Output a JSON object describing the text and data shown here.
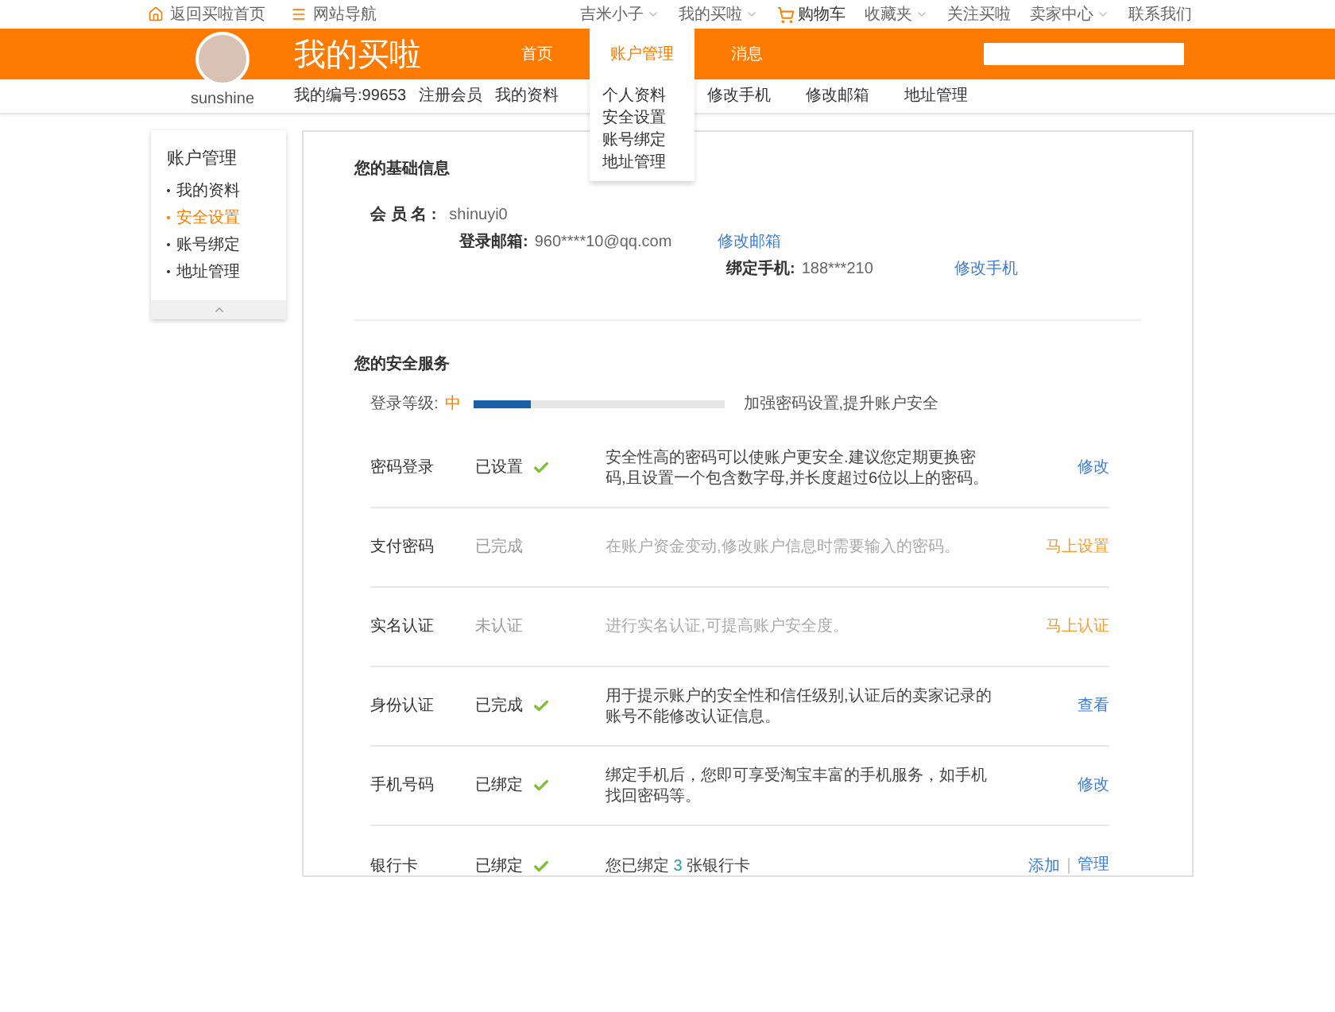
{
  "top_bar": {
    "left": [
      {
        "label": "返回买啦首页",
        "kind": "home"
      },
      {
        "label": "网站导航",
        "kind": "menu"
      }
    ],
    "right": [
      {
        "label": "吉米小子",
        "kind": "plain",
        "dropdown": true
      },
      {
        "label": "我的买啦",
        "kind": "plain",
        "dropdown": true
      },
      {
        "label": "购物车",
        "kind": "cart",
        "dropdown": false
      },
      {
        "label": "收藏夹",
        "kind": "plain",
        "dropdown": true
      },
      {
        "label": "关注买啦",
        "kind": "plain",
        "dropdown": false
      },
      {
        "label": "卖家中心",
        "kind": "plain",
        "dropdown": true
      },
      {
        "label": "联系我们",
        "kind": "plain",
        "dropdown": false
      }
    ]
  },
  "header": {
    "title": "我的买啦",
    "username": "sunshine",
    "nav": [
      {
        "label": "首页",
        "selected": false
      },
      {
        "label": "账户管理",
        "selected": true,
        "expanded": true,
        "menu": [
          "个人资料",
          "安全设置",
          "账号绑定",
          "地址管理"
        ]
      },
      {
        "label": "消息",
        "selected": false
      }
    ]
  },
  "subnav": {
    "left": [
      "我的编号:99653",
      "注册会员",
      "我的资料"
    ],
    "right": [
      "修改手机",
      "修改邮箱",
      "地址管理"
    ]
  },
  "sidebar": {
    "title": "账户管理",
    "items": [
      {
        "label": "我的资料",
        "selected": false
      },
      {
        "label": "安全设置",
        "selected": true
      },
      {
        "label": "账号绑定",
        "selected": false
      },
      {
        "label": "地址管理",
        "selected": false
      }
    ]
  },
  "basic_info": {
    "title": "您的基础信息",
    "member_label": "会 员 名 :",
    "member_value": "shinuyi0",
    "email_label": "登录邮箱:",
    "email_value": "960****10@qq.com",
    "email_link": "修改邮箱",
    "phone_label": "绑定手机:",
    "phone_value": "188***210",
    "phone_link": "修改手机"
  },
  "security": {
    "title": "您的安全服务",
    "level_label": "登录等级:",
    "level_value": "中",
    "level": 0.23,
    "level_hint": "加强密码设置,提升账户安全",
    "rows": [
      {
        "name": "密码登录",
        "status": "已设置",
        "done": true,
        "description": [
          {
            "text": "安全性高的密码可以使账户更安全.建议您定期更换密码,且设置一个包含数字母,并长度超过6位以上的密码。",
            "kind": "plain"
          }
        ],
        "actions": [
          "修改"
        ]
      },
      {
        "name": "支付密码",
        "status": "已完成",
        "done": false,
        "description": [
          {
            "text": "在账户资金变动,修改账户信息时需要输入的密码。",
            "kind": "plain"
          }
        ],
        "actions": [
          "马上设置"
        ]
      },
      {
        "name": "实名认证",
        "status": "未认证",
        "done": false,
        "description": [
          {
            "text": "进行实名认证,可提高账户安全度。",
            "kind": "plain"
          }
        ],
        "actions": [
          "马上认证"
        ]
      },
      {
        "name": "身份认证",
        "status": "已完成",
        "done": true,
        "description": [
          {
            "text": "用于提示账户的安全性和信任级别,认证后的卖家记录的账号不能修改认证信息。",
            "kind": "plain"
          }
        ],
        "actions": [
          "查看"
        ]
      },
      {
        "name": "手机号码",
        "status": "已绑定",
        "done": true,
        "description": [
          {
            "text": "绑定手机后，您即可享受淘宝丰富的手机服务，如手机找回密码等。",
            "kind": "plain"
          }
        ],
        "actions": [
          "修改"
        ]
      },
      {
        "name": "银行卡",
        "status": "已绑定",
        "done": true,
        "description": [
          {
            "text": "您已绑定 ",
            "kind": "plain"
          },
          {
            "text": "3",
            "kind": "count"
          },
          {
            "text": " 张银行卡",
            "kind": "plain"
          }
        ],
        "actions": [
          "添加",
          "管理"
        ]
      }
    ]
  }
}
